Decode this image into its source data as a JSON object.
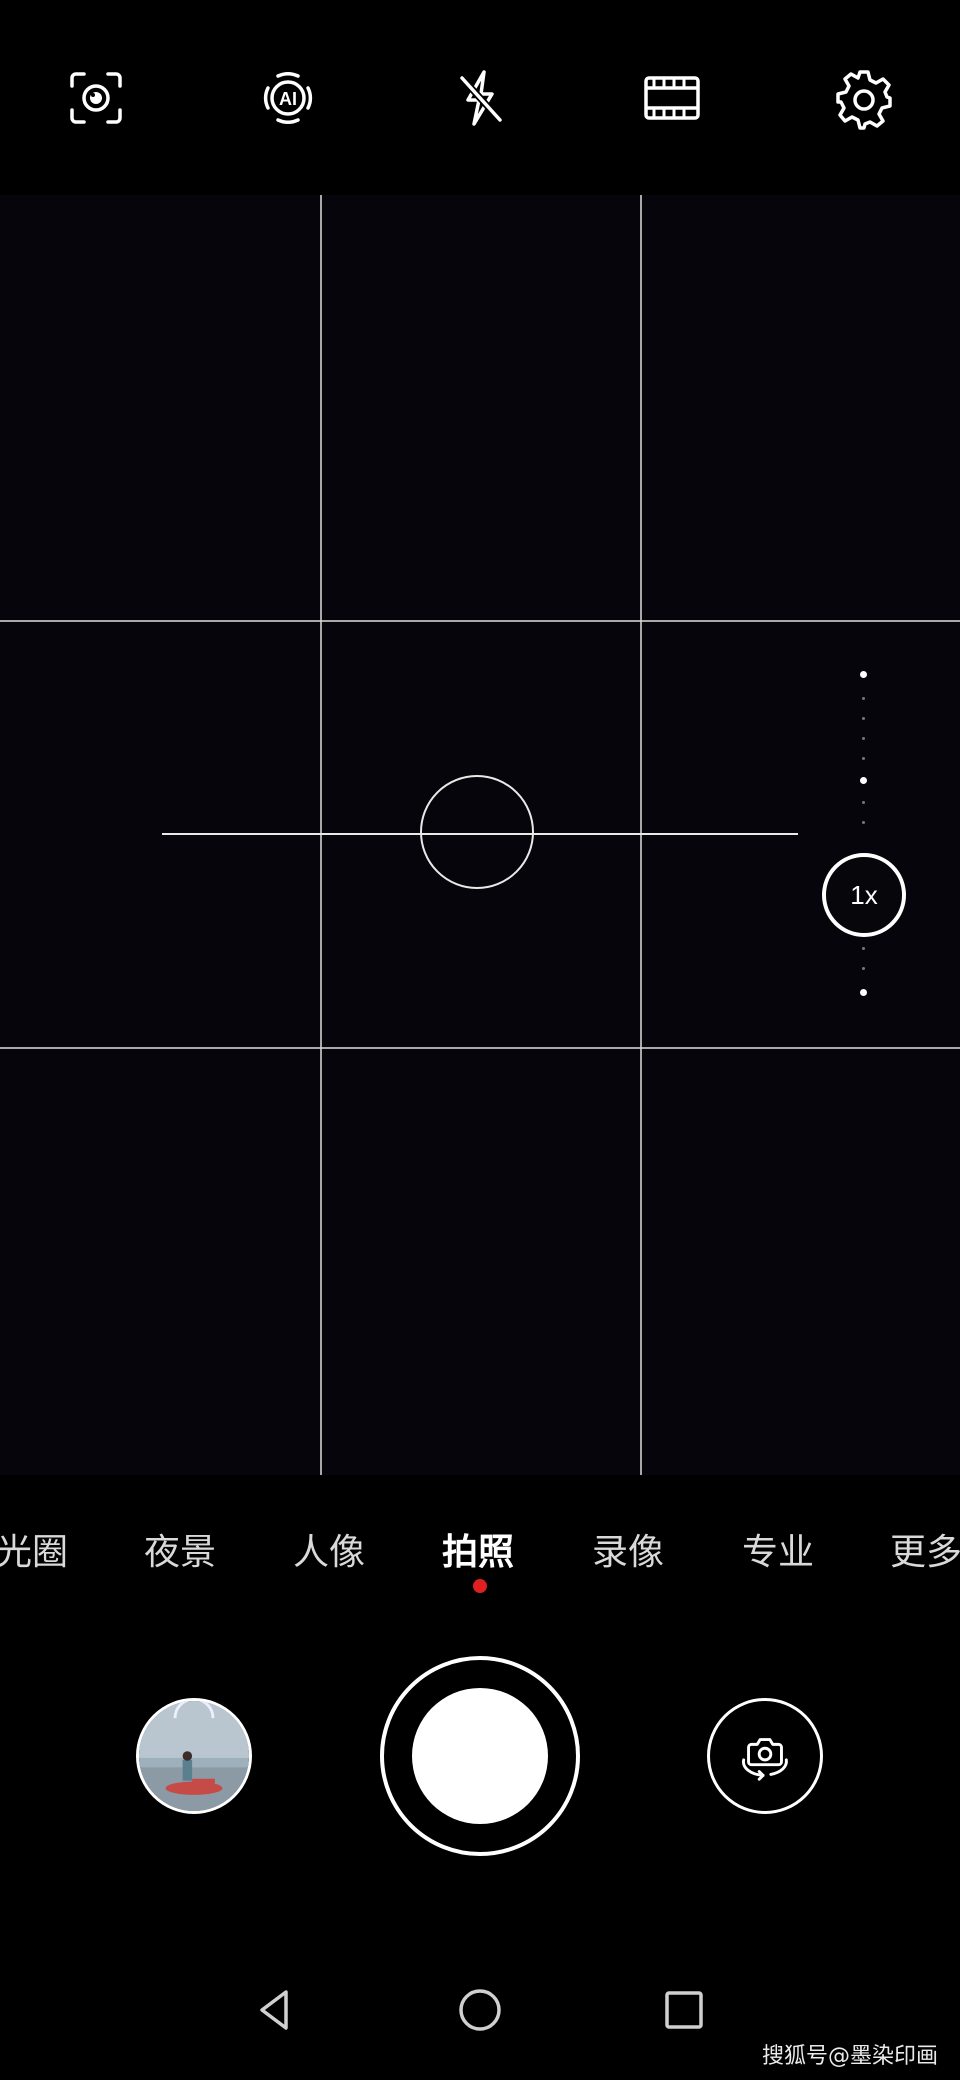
{
  "toolbar": {
    "items": [
      {
        "name": "scene-recognition",
        "icon": "focus-eye-icon"
      },
      {
        "name": "ai-mode",
        "icon": "ai-icon",
        "label": "AI"
      },
      {
        "name": "flash-off",
        "icon": "flash-off-icon"
      },
      {
        "name": "filter",
        "icon": "film-strip-icon"
      },
      {
        "name": "settings",
        "icon": "gear-icon"
      }
    ]
  },
  "viewfinder": {
    "grid": "3x3",
    "zoom": {
      "label": "1x",
      "value": 1
    }
  },
  "modes": {
    "items": [
      {
        "label": "光圈",
        "active": false
      },
      {
        "label": "夜景",
        "active": false
      },
      {
        "label": "人像",
        "active": false
      },
      {
        "label": "拍照",
        "active": true
      },
      {
        "label": "录像",
        "active": false
      },
      {
        "label": "专业",
        "active": false
      },
      {
        "label": "更多",
        "active": false
      }
    ],
    "indicator_color": "#e02020"
  },
  "controls": {
    "gallery_icon": "gallery-thumbnail",
    "shutter_icon": "shutter-button",
    "switch_icon": "camera-switch-icon"
  },
  "navbar": {
    "items": [
      {
        "name": "back",
        "icon": "triangle-back-icon"
      },
      {
        "name": "home",
        "icon": "circle-home-icon"
      },
      {
        "name": "recents",
        "icon": "square-recents-icon"
      }
    ]
  },
  "watermark": "搜狐号@墨染印画"
}
